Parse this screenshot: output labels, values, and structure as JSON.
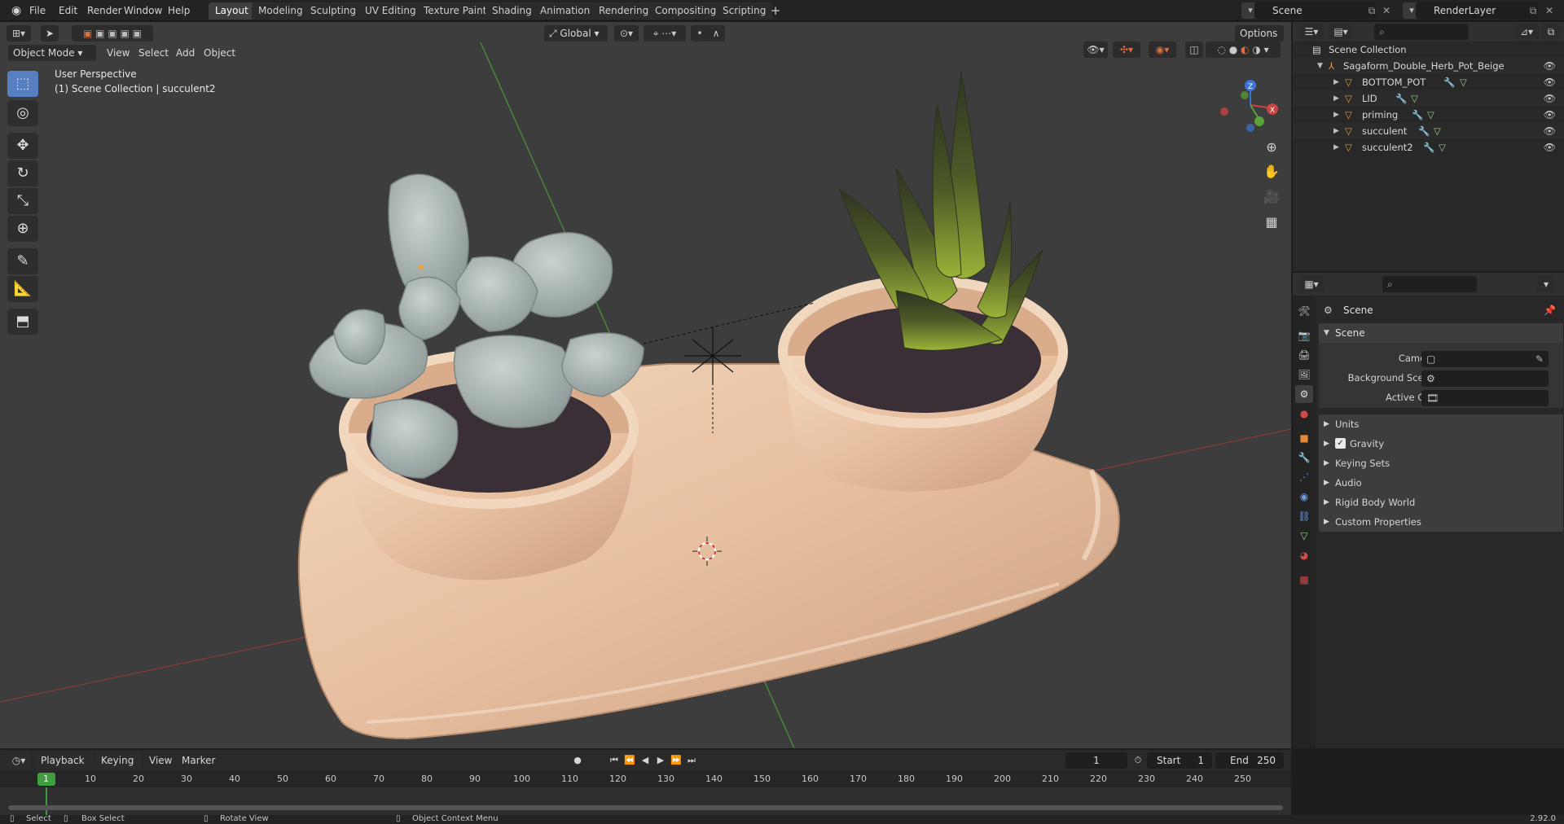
{
  "topbar": {
    "menus": [
      "File",
      "Edit",
      "Render",
      "Window",
      "Help"
    ],
    "workspaces": [
      "Layout",
      "Modeling",
      "Sculpting",
      "UV Editing",
      "Texture Paint",
      "Shading",
      "Animation",
      "Rendering",
      "Compositing",
      "Scripting"
    ],
    "active_workspace": "Layout",
    "add_tab": "+",
    "scene_name": "Scene",
    "view_layer": "RenderLayer"
  },
  "viewport": {
    "mode": "Object Mode",
    "menus": [
      "View",
      "Select",
      "Add",
      "Object"
    ],
    "orientation": "Global",
    "options_label": "Options",
    "perspective_label": "User Perspective",
    "collection_label": "(1) Scene Collection | succulent2",
    "gizmo_axes": [
      "Z",
      "Y",
      "X"
    ]
  },
  "outliner": {
    "root": "Scene Collection",
    "parent": "Sagaform_Double_Herb_Pot_Beige",
    "children": [
      "BOTTOM_POT",
      "LID",
      "priming",
      "succulent",
      "succulent2"
    ]
  },
  "properties": {
    "context": "Scene",
    "panel": "Scene",
    "fields": [
      {
        "label": "Camera",
        "value": ""
      },
      {
        "label": "Background Scene",
        "value": ""
      },
      {
        "label": "Active Clip",
        "value": ""
      }
    ],
    "subpanels": [
      "Units",
      "Gravity",
      "Keying Sets",
      "Audio",
      "Rigid Body World",
      "Custom Properties"
    ],
    "gravity_checked": true
  },
  "timeline": {
    "menus": [
      "Playback",
      "Keying",
      "View",
      "Marker"
    ],
    "current_frame": "1",
    "start_label": "Start",
    "start_value": "1",
    "end_label": "End",
    "end_value": "250",
    "ruler": [
      "1",
      "10",
      "20",
      "30",
      "40",
      "50",
      "60",
      "70",
      "80",
      "90",
      "100",
      "110",
      "120",
      "130",
      "140",
      "150",
      "160",
      "170",
      "180",
      "190",
      "200",
      "210",
      "220",
      "230",
      "240",
      "250"
    ]
  },
  "statusbar": {
    "select": "Select",
    "box_select": "Box Select",
    "rotate_view": "Rotate View",
    "context_menu": "Object Context Menu",
    "version": "2.92.0"
  },
  "colors": {
    "accent": "#5680c2",
    "active_frame": "#3f9f3f",
    "pot": "#e9c4a4",
    "soil": "#3a2f36",
    "succulent_left": "#a9b6b3",
    "succulent_right": "#4f5d27"
  }
}
